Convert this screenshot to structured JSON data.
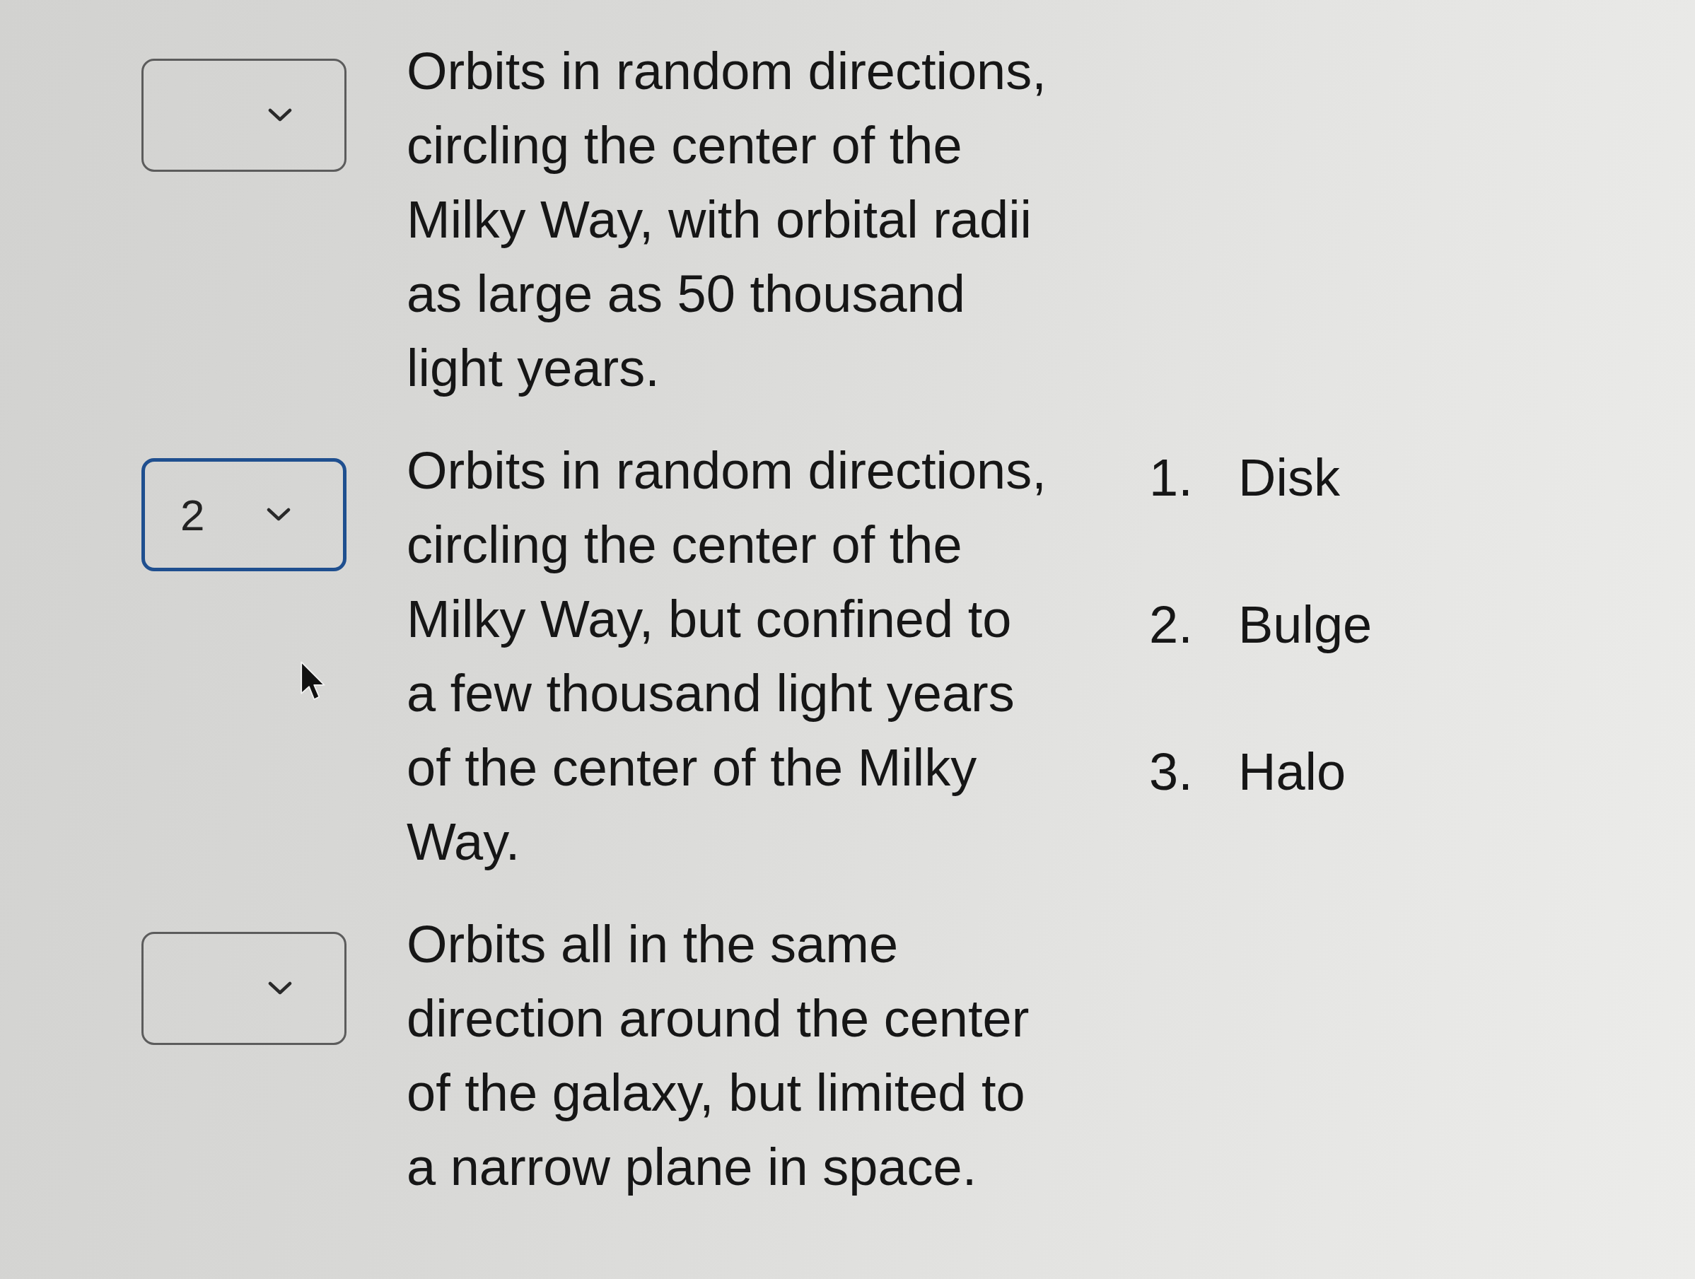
{
  "questions": [
    {
      "answer": {
        "focused": false
      },
      "description": "Orbits in random directions,\ncircling the center of the\nMilky Way, with orbital radii\nas large as 50 thousand\nlight years."
    },
    {
      "answer": {
        "value": "2",
        "focused": true
      },
      "description": "Orbits in random directions,\ncircling the center of the\nMilky Way, but confined to\na few thousand light years\nof the center of the Milky\nWay."
    },
    {
      "answer": {
        "focused": false
      },
      "description": "Orbits all in the same\ndirection around the center\nof the galaxy, but limited to\na narrow plane in space."
    }
  ],
  "choices": [
    {
      "number": "1.",
      "label": "Disk"
    },
    {
      "number": "2.",
      "label": "Bulge"
    },
    {
      "number": "3.",
      "label": "Halo"
    }
  ]
}
